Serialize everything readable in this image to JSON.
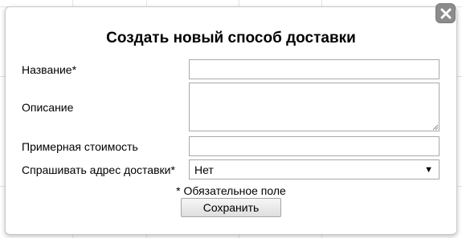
{
  "dialog": {
    "title": "Создать новый способ доставки",
    "close_icon": "close-icon"
  },
  "form": {
    "name_label": "Название*",
    "name_value": "",
    "description_label": "Описание",
    "description_value": "",
    "cost_label": "Примерная стоимость",
    "cost_value": "",
    "ask_address_label": "Спрашивать адрес доставки*",
    "ask_address_selected": "Нет",
    "required_note": "* Обязательное поле",
    "save_label": "Сохранить"
  },
  "colors": {
    "close_button_bg": "#8c8c8c",
    "field_border": "#a9a9a9"
  }
}
